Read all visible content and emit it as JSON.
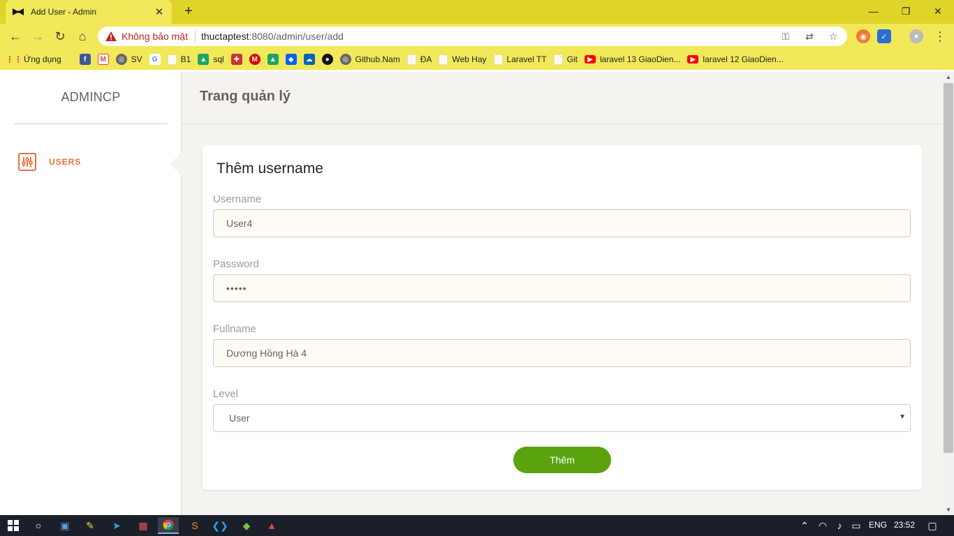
{
  "browser": {
    "tab_title": "Add User - Admin",
    "insecure_label": "Không bảo mật",
    "url_host": "thuctaptest",
    "url_path": ":8080/admin/user/add",
    "bookmarks": [
      "Ứng dụng",
      "SV",
      "B1",
      "sql",
      "Github.Nam",
      "ĐA",
      "Web Hay",
      "Laravel TT",
      "Git",
      "laravel 13 GiaoDien...",
      "laravel 12 GiaoDien..."
    ]
  },
  "sidebar": {
    "brand": "ADMINCP",
    "items": [
      {
        "label": "USERS"
      }
    ]
  },
  "header": {
    "title": "Trang quản lý"
  },
  "form": {
    "title": "Thêm username",
    "username_label": "Username",
    "username_value": "User4",
    "password_label": "Password",
    "password_value": "•••••",
    "fullname_label": "Fullname",
    "fullname_value": "Dương Hồng Hà 4",
    "level_label": "Level",
    "level_value": "User",
    "submit_label": "Thêm"
  },
  "taskbar": {
    "lang": "ENG",
    "time": "23:52"
  },
  "colors": {
    "accent": "#ef6c3e",
    "submit": "#5aa30f",
    "chrome": "#e0d42a"
  }
}
